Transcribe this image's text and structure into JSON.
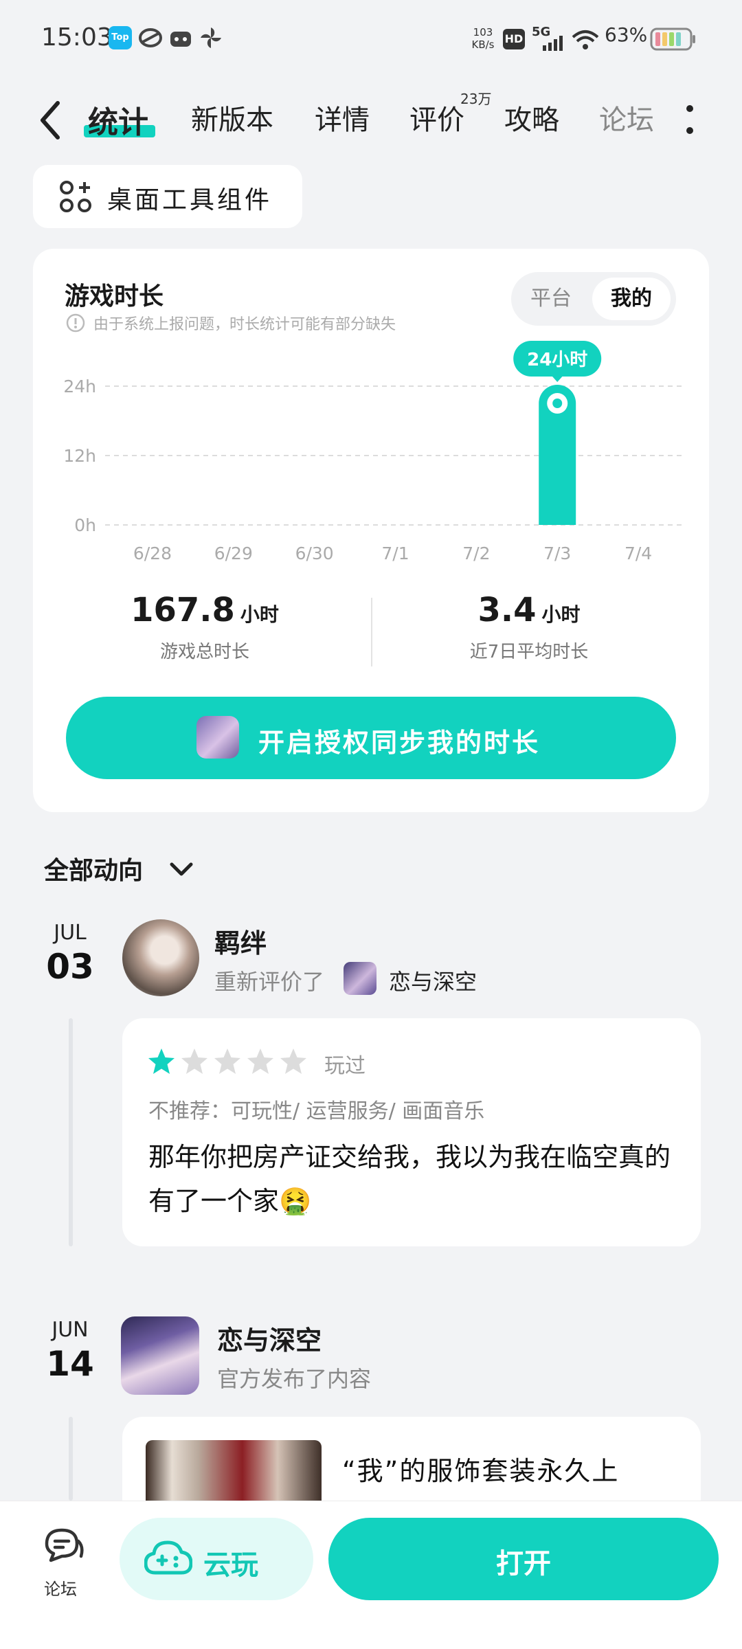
{
  "status_bar": {
    "time": "15:03",
    "network_speed_value": "103",
    "network_speed_unit": "KB/s",
    "hd_label": "HD",
    "signal_label": "5G",
    "battery": "63%"
  },
  "nav": {
    "tabs": [
      {
        "label": "统计",
        "active": true
      },
      {
        "label": "新版本"
      },
      {
        "label": "详情"
      },
      {
        "label": "评价",
        "badge": "23万"
      },
      {
        "label": "攻略"
      },
      {
        "label": "论坛"
      }
    ]
  },
  "widget_chip": {
    "label": "桌面工具组件"
  },
  "game_time_card": {
    "title": "游戏时长",
    "note": "由于系统上报问题，时长统计可能有部分缺失",
    "segments": [
      "平台",
      "我的"
    ],
    "active_segment": "我的",
    "total_value": "167.8",
    "total_unit": "小时",
    "total_label": "游戏总时长",
    "avg_value": "3.4",
    "avg_unit": "小时",
    "avg_label": "近7日平均时长",
    "sync_button": "开启授权同步我的时长"
  },
  "chart_data": {
    "type": "bar",
    "categories": [
      "6/28",
      "6/29",
      "6/30",
      "7/1",
      "7/2",
      "7/3",
      "7/4"
    ],
    "values": [
      0,
      0,
      0,
      0,
      0,
      24,
      0
    ],
    "y_ticks": [
      "24h",
      "12h",
      "0h"
    ],
    "ylim": [
      0,
      24
    ],
    "highlight_label": "24小时",
    "highlight_index": 5,
    "bar_color": "#12d2bf",
    "grid": true
  },
  "activity": {
    "filter_label": "全部动向",
    "items": [
      {
        "month": "JUL",
        "day": "03",
        "user": "羁绊",
        "action": "重新评价了",
        "game": "恋与深空",
        "rating": 1,
        "rating_max": 5,
        "played": "玩过",
        "tags": "不推荐：可玩性/ 运营服务/ 画面音乐",
        "text": "那年你把房产证交给我，我以为我在临空真的有了一个家🤮"
      },
      {
        "month": "JUN",
        "day": "14",
        "user": "恋与深空",
        "action": "官方发布了内容",
        "post_title": "“我”的服饰套装永久上"
      }
    ]
  },
  "bottom_bar": {
    "forum_label": "论坛",
    "cloud_label": "云玩",
    "open_label": "打开"
  },
  "colors": {
    "accent": "#12d2bf",
    "star_on": "#12d2bf",
    "star_off": "#dcdcdc"
  }
}
